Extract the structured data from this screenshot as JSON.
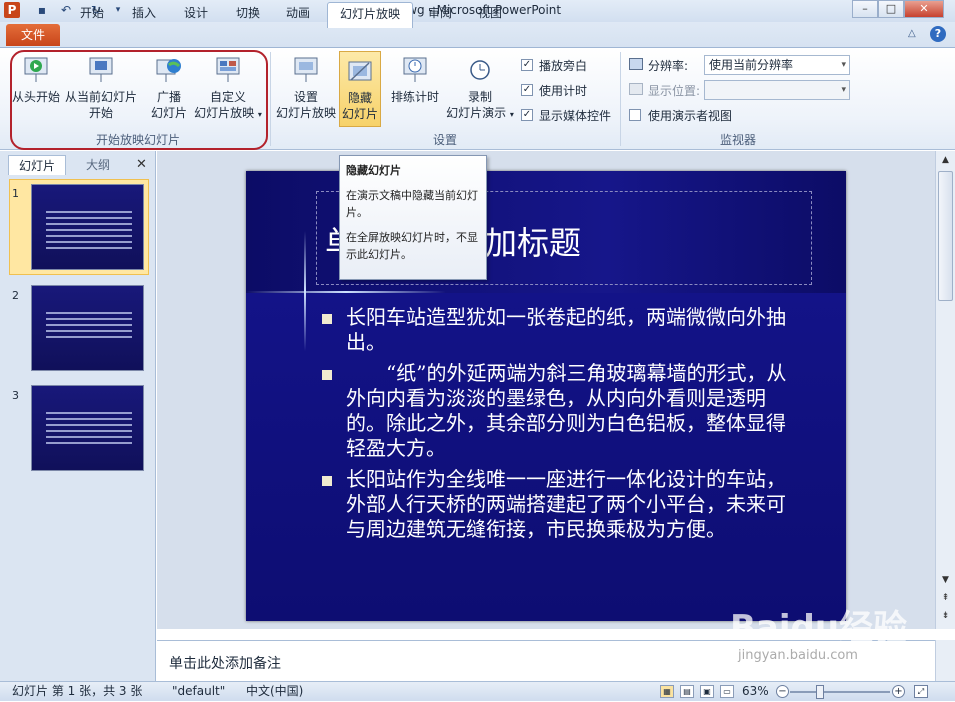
{
  "window": {
    "title": "yswg - Microsoft PowerPoint",
    "minimize": "–",
    "maximize": "□",
    "close": "✕"
  },
  "tabs": [
    "文件",
    "开始",
    "插入",
    "设计",
    "切换",
    "动画",
    "幻灯片放映",
    "审阅",
    "视图"
  ],
  "active_tab": "幻灯片放映",
  "ribbon": {
    "group_start": {
      "label": "开始放映幻灯片",
      "from_beginning": "从头开始",
      "from_current_1": "从当前幻灯片",
      "from_current_2": "开始",
      "broadcast_1": "广播",
      "broadcast_2": "幻灯片",
      "custom_1": "自定义",
      "custom_2": "幻灯片放映"
    },
    "group_setup": {
      "label": "设置",
      "setup_1": "设置",
      "setup_2": "幻灯片放映",
      "hide_1": "隐藏",
      "hide_2": "幻灯片",
      "rehearse": "排练计时",
      "record_1": "录制",
      "record_2": "幻灯片演示",
      "play_narrations": "播放旁白",
      "use_timings": "使用计时",
      "show_media_controls": "显示媒体控件"
    },
    "group_monitors": {
      "label": "监视器",
      "resolution_label": "分辨率:",
      "resolution_value": "使用当前分辨率",
      "show_on_label": "显示位置:",
      "presenter_view": "使用演示者视图"
    }
  },
  "tooltip": {
    "title": "隐藏幻灯片",
    "p1": "在演示文稿中隐藏当前幻灯片。",
    "p2": "在全屏放映幻灯片时，不显示此幻灯片。"
  },
  "panel": {
    "tab_slides": "幻灯片",
    "tab_outline": "大纲",
    "close": "✕",
    "slide_numbers": [
      "1",
      "2",
      "3"
    ]
  },
  "slide": {
    "title": "单击此处添加标题",
    "bullets": [
      "长阳车站造型犹如一张卷起的纸，两端微微向外抽出。",
      "“纸”的外延两端为斜三角玻璃幕墙的形式，从外向内看为淡淡的墨绿色，从内向外看则是透明的。除此之外，其余部分则为白色铝板，整体显得轻盈大方。",
      "长阳站作为全线唯一一座进行一体化设计的车站，外部人行天桥的两端搭建起了两个小平台，未来可与周边建筑无缝衔接，市民换乘极为方便。"
    ]
  },
  "notes": {
    "placeholder": "单击此处添加备注"
  },
  "status": {
    "slide_info": "幻灯片 第 1 张，共 3 张",
    "theme": "\"default\"",
    "language": "中文(中国)",
    "zoom": "63%"
  },
  "watermark": {
    "main": "Baidu经验",
    "sub": "jingyan.baidu.com"
  },
  "colors": {
    "file_tab": "#d9551f",
    "slide_bg": "#111174",
    "highlight": "#b3222c"
  }
}
